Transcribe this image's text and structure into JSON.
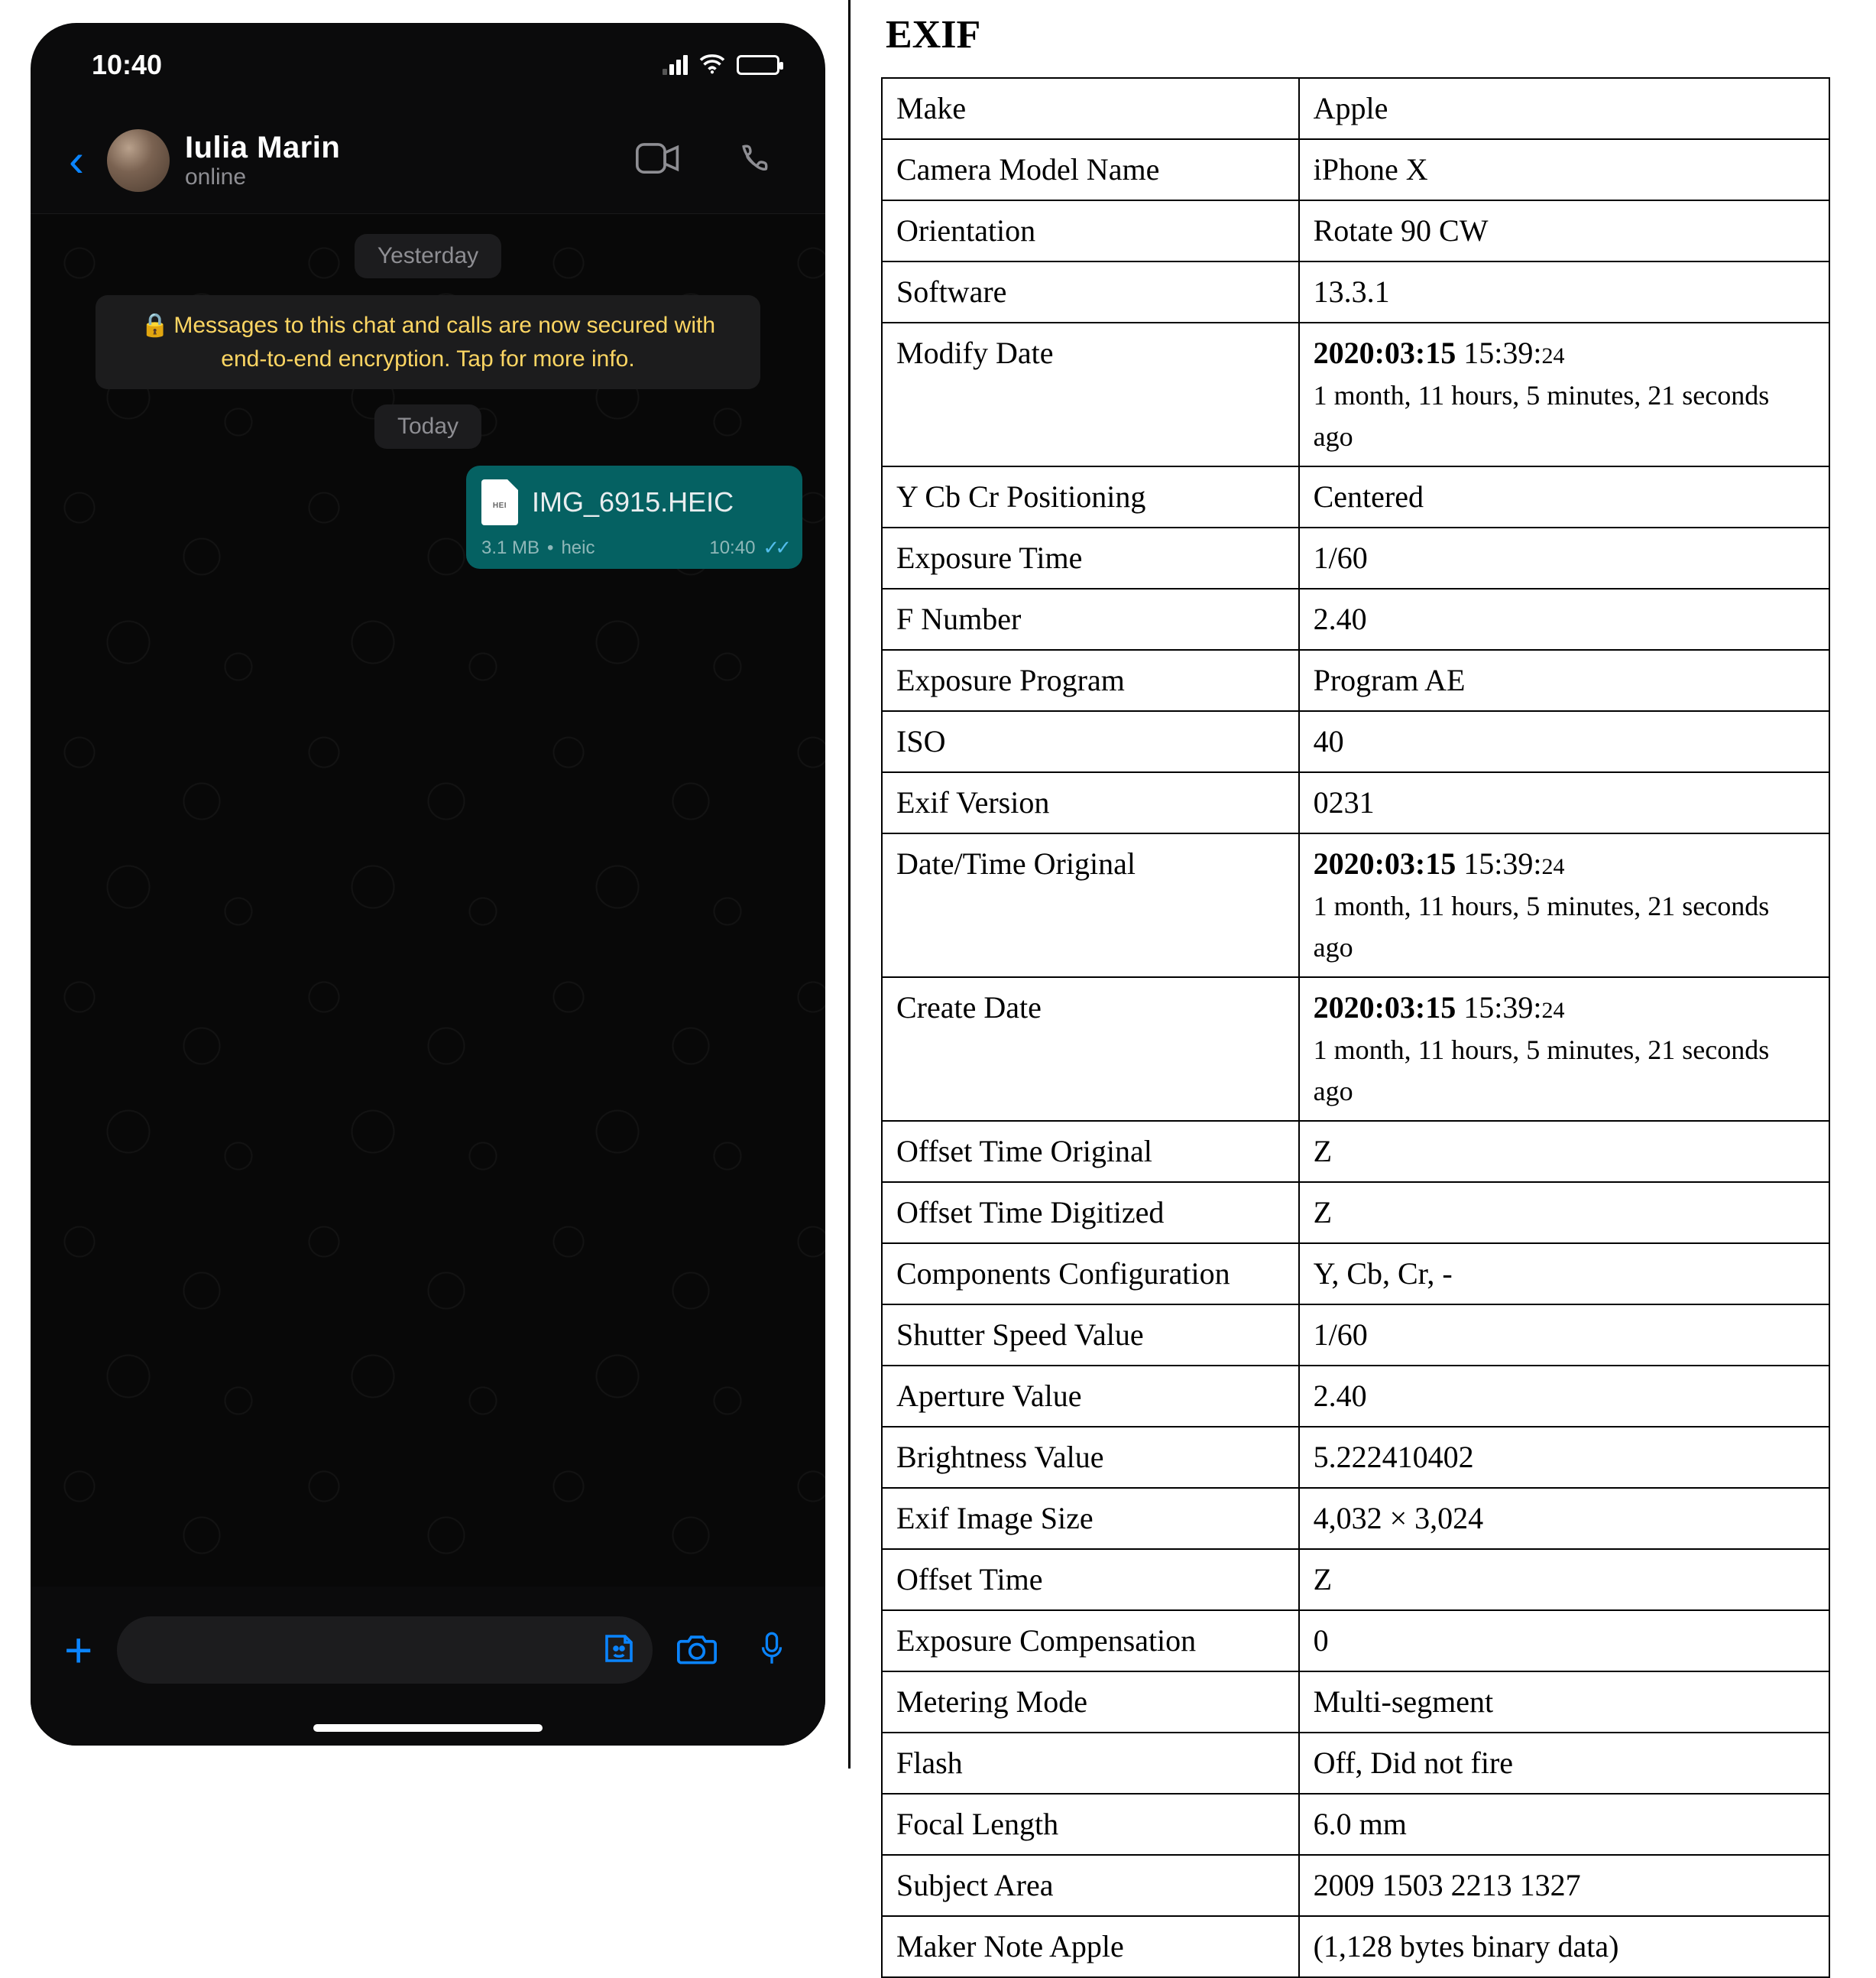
{
  "statusbar": {
    "time": "10:40"
  },
  "chat": {
    "contact_name": "Iulia  Marin",
    "contact_status": "online",
    "day1": "Yesterday",
    "encryption_banner": "Messages to this chat and calls are now secured with end-to-end encryption. Tap for more info.",
    "day2": "Today",
    "bubble": {
      "file_name": "IMG_6915.HEIC",
      "file_badge": "HEI",
      "size": "3.1 MB",
      "sep": "•",
      "ext": "heic",
      "time": "10:40"
    }
  },
  "exif": {
    "title": "EXIF",
    "rows": [
      {
        "k": "Make",
        "v": "Apple"
      },
      {
        "k": "Camera Model Name",
        "v": "iPhone X"
      },
      {
        "k": "Orientation",
        "v": "Rotate 90 CW"
      },
      {
        "k": "Software",
        "v": "13.3.1"
      },
      {
        "k": "Modify Date",
        "dt": {
          "date": "2020:03:15",
          "hm": "15:39:",
          "sec": "24",
          "rel": "1 month, 11 hours, 5 minutes, 21 seconds ago"
        }
      },
      {
        "k": "Y Cb Cr Positioning",
        "v": "Centered"
      },
      {
        "k": "Exposure Time",
        "v": "1/60"
      },
      {
        "k": "F Number",
        "v": "2.40"
      },
      {
        "k": "Exposure Program",
        "v": "Program AE"
      },
      {
        "k": "ISO",
        "v": "40"
      },
      {
        "k": "Exif Version",
        "v": "0231"
      },
      {
        "k": "Date/Time Original",
        "dt": {
          "date": "2020:03:15",
          "hm": "15:39:",
          "sec": "24",
          "rel": "1 month, 11 hours, 5 minutes, 21 seconds ago"
        }
      },
      {
        "k": "Create Date",
        "dt": {
          "date": "2020:03:15",
          "hm": "15:39:",
          "sec": "24",
          "rel": "1 month, 11 hours, 5 minutes, 21 seconds ago"
        }
      },
      {
        "k": "Offset Time Original",
        "v": "Z"
      },
      {
        "k": "Offset Time Digitized",
        "v": "Z"
      },
      {
        "k": "Components Configuration",
        "v": "Y, Cb, Cr, -"
      },
      {
        "k": "Shutter Speed Value",
        "v": "1/60"
      },
      {
        "k": "Aperture Value",
        "v": "2.40"
      },
      {
        "k": "Brightness Value",
        "v": "5.222410402"
      },
      {
        "k": "Exif Image Size",
        "v": "4,032 × 3,024"
      },
      {
        "k": "Offset Time",
        "v": "Z"
      },
      {
        "k": "Exposure Compensation",
        "v": "0"
      },
      {
        "k": "Metering Mode",
        "v": "Multi-segment"
      },
      {
        "k": "Flash",
        "v": "Off, Did not fire"
      },
      {
        "k": "Focal Length",
        "v": "6.0 mm"
      },
      {
        "k": "Subject Area",
        "v": "2009 1503 2213 1327"
      },
      {
        "k": "Maker Note Apple",
        "v": "(1,128 bytes binary data)"
      }
    ]
  }
}
